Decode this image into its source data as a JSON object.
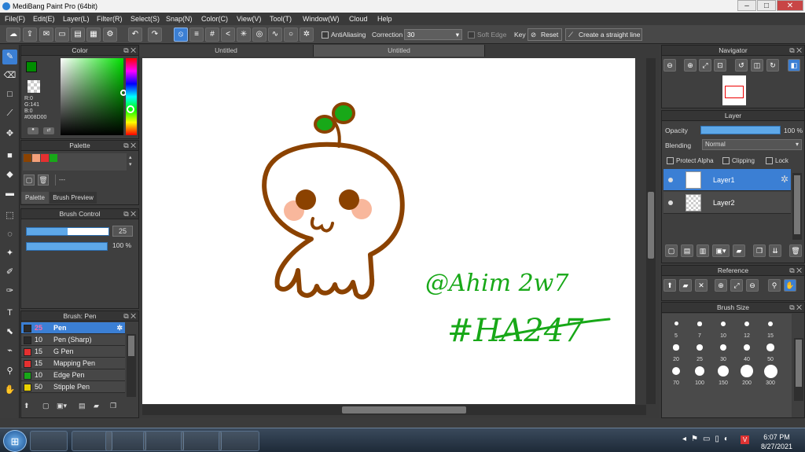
{
  "window": {
    "title": "MediBang Paint Pro (64bit)",
    "minimize": "–",
    "maximize": "□",
    "close": "✕"
  },
  "menu": [
    "File(F)",
    "Edit(E)",
    "Layer(L)",
    "Filter(R)",
    "Select(S)",
    "Snap(N)",
    "Color(C)",
    "View(V)",
    "Tool(T)",
    "Window(W)",
    "Cloud",
    "Help"
  ],
  "toolbar": {
    "antialiasing": "AntiAliasing",
    "correction_label": "Correction",
    "correction_value": "30",
    "soft_edge": "Soft Edge",
    "key": "Key",
    "reset": "Reset",
    "straight_line": "Create a straight line"
  },
  "tabs": [
    "Untitled",
    "Untitled"
  ],
  "color_panel": {
    "title": "Color",
    "r": "R:0",
    "g": "G:141",
    "b": "B:0",
    "hex": "#008D00",
    "fg": "#008d00",
    "bg": "#8b4200"
  },
  "palette": {
    "title": "Palette",
    "swatches": [
      "#8b4200",
      "#f4a07a",
      "#e53030",
      "#18a818"
    ],
    "dash": "---",
    "tab_palette": "Palette",
    "tab_preview": "Brush Preview"
  },
  "brush_control": {
    "title": "Brush Control",
    "size": "25",
    "opacity": "100 %",
    "size_fraction": 0.5
  },
  "brush_list": {
    "title": "Brush: Pen",
    "items": [
      {
        "size": "25",
        "name": "Pen",
        "color": "#2b2b2b"
      },
      {
        "size": "10",
        "name": "Pen (Sharp)",
        "color": "#2b2b2b"
      },
      {
        "size": "15",
        "name": "G Pen",
        "color": "#e53030"
      },
      {
        "size": "15",
        "name": "Mapping Pen",
        "color": "#e53030"
      },
      {
        "size": "10",
        "name": "Edge Pen",
        "color": "#18a818"
      },
      {
        "size": "50",
        "name": "Stipple Pen",
        "color": "#e8d000"
      }
    ]
  },
  "canvas": {
    "handle_text": "@Ahim 2w7",
    "tag_text": "#HA247",
    "brown": "#8b4200",
    "green": "#18a818",
    "cheek": "#f8b79c"
  },
  "navigator": {
    "title": "Navigator"
  },
  "layer_panel": {
    "title": "Layer",
    "opacity_label": "Opacity",
    "opacity_value": "100 %",
    "blending_label": "Blending",
    "blending_value": "Normal",
    "protect_alpha": "Protect Alpha",
    "clipping": "Clipping",
    "lock": "Lock",
    "layers": [
      "Layer1",
      "Layer2"
    ]
  },
  "reference": {
    "title": "Reference"
  },
  "brush_size": {
    "title": "Brush Size",
    "sizes": [
      "5",
      "7",
      "10",
      "12",
      "15",
      "20",
      "25",
      "30",
      "40",
      "50",
      "70",
      "100",
      "150",
      "200",
      "300"
    ]
  },
  "taskbar": {
    "time": "6:07 PM",
    "date": "8/27/2021"
  }
}
